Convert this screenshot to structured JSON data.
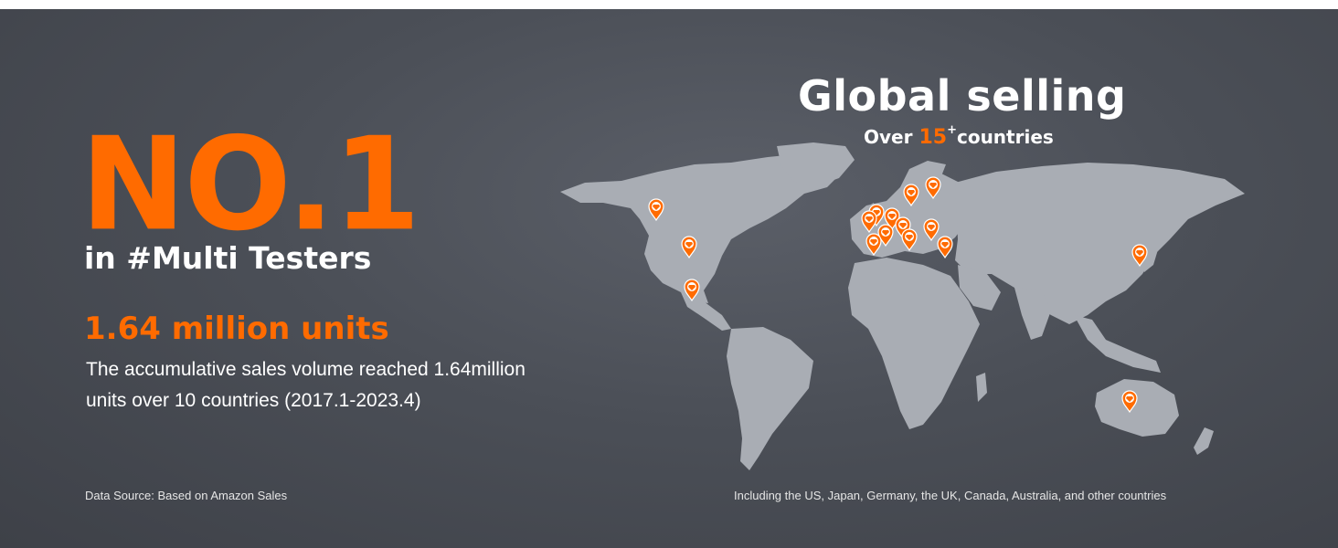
{
  "accent_color": "#ff6b00",
  "land_color": "#a9adb4",
  "left": {
    "rank": "NO.1",
    "category": "in #Multi Testers",
    "units_headline": "1.64 million units",
    "description_line1": "The accumulative sales volume reached 1.64million",
    "description_line2": "units over 10 countries (2017.1-2023.4)",
    "source": "Data Source: Based on Amazon Sales"
  },
  "right": {
    "title": "Global selling",
    "subtitle_prefix": "Over",
    "subtitle_number": "15",
    "subtitle_sup": "+",
    "subtitle_suffix": "countries",
    "note": "Including the US, Japan, Germany, the UK, Canada, Australia, and other countries"
  },
  "map": {
    "pin_icon": "store-location-pin-icon",
    "markers": [
      {
        "name": "canada-west"
      },
      {
        "name": "usa"
      },
      {
        "name": "mexico"
      },
      {
        "name": "uk"
      },
      {
        "name": "ireland"
      },
      {
        "name": "netherlands"
      },
      {
        "name": "germany"
      },
      {
        "name": "france"
      },
      {
        "name": "spain"
      },
      {
        "name": "italy"
      },
      {
        "name": "poland"
      },
      {
        "name": "sweden"
      },
      {
        "name": "finland"
      },
      {
        "name": "turkey"
      },
      {
        "name": "japan"
      },
      {
        "name": "australia"
      }
    ]
  }
}
